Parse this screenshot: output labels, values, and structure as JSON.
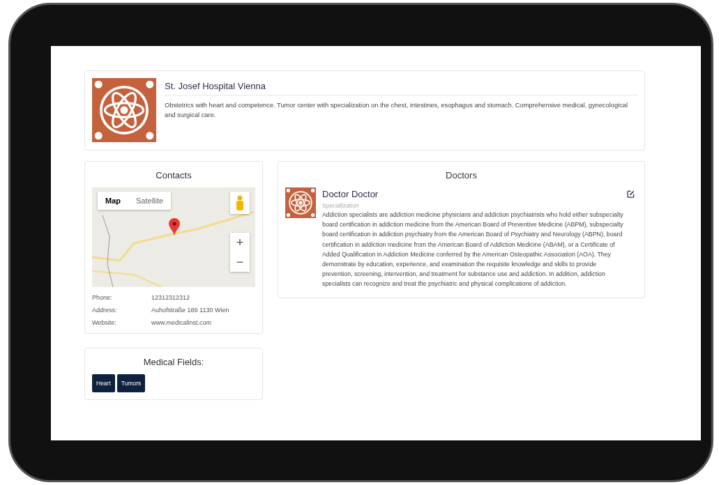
{
  "hospital": {
    "name": "St. Josef Hospital Vienna",
    "description": "Obstetrics with heart and competence. Tumor center with specialization on the chest, intestines, esophagus and stomach. Comprehensive medical, gynecological and surgical care."
  },
  "contacts": {
    "title": "Contacts",
    "map_types": [
      {
        "label": "Map",
        "selected": true
      },
      {
        "label": "Satellite",
        "selected": false
      }
    ],
    "zoom_in": "+",
    "zoom_out": "−",
    "rows": [
      {
        "label": "Phone:",
        "value": "12312312312"
      },
      {
        "label": "Address:",
        "value": "Auhofstraße 189 1130 Wien"
      },
      {
        "label": "Website:",
        "value": "www.medicalinst.com"
      }
    ]
  },
  "medical_fields": {
    "title": "Medical Fields:",
    "tags": [
      "Heart",
      "Tumors"
    ]
  },
  "doctors": {
    "title": "Doctors",
    "items": [
      {
        "name": "Doctor Doctor",
        "specialization": "Specialization",
        "bio": "Addiction specialists are addiction medicine physicians and addiction psychiatrists who hold either subspecialty board certification in addiction medicine from the American Board of Preventive Medicine (ABPM), subspecialty board certification in addiction psychiatry from the American Board of Psychiatry and Neurology (ABPN), board certification in addiction medicine from the American Board of Addiction Medicine (ABAM), or a Certificate of Added Qualification in Addiction Medicine conferred by the American Osteopathic Association (AOA). They demonstrate by education, experience, and examination the requisite knowledge and skills to provide prevention, screening, intervention, and treatment for substance use and addiction. In addition, addiction specialists can recognize and treat the psychiatric and physical complications of addiction."
      }
    ]
  }
}
